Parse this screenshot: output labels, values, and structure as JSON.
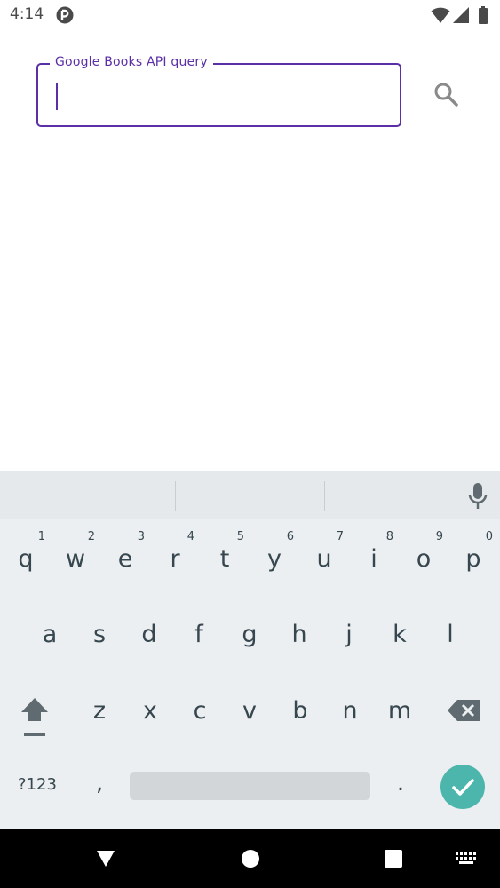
{
  "status_bar": {
    "time": "4:14"
  },
  "search": {
    "label": "Google Books API query",
    "value": "",
    "placeholder": ""
  },
  "keyboard": {
    "row1": [
      {
        "key": "q",
        "hint": "1"
      },
      {
        "key": "w",
        "hint": "2"
      },
      {
        "key": "e",
        "hint": "3"
      },
      {
        "key": "r",
        "hint": "4"
      },
      {
        "key": "t",
        "hint": "5"
      },
      {
        "key": "y",
        "hint": "6"
      },
      {
        "key": "u",
        "hint": "7"
      },
      {
        "key": "i",
        "hint": "8"
      },
      {
        "key": "o",
        "hint": "9"
      },
      {
        "key": "p",
        "hint": "0"
      }
    ],
    "row2": [
      "a",
      "s",
      "d",
      "f",
      "g",
      "h",
      "j",
      "k",
      "l"
    ],
    "row3": [
      "z",
      "x",
      "c",
      "v",
      "b",
      "n",
      "m"
    ],
    "symbols_label": "?123",
    "comma": ",",
    "period": "."
  },
  "colors": {
    "accent": "#5b2fa6",
    "keyboard_bg": "#eceff1",
    "key_text": "#37474f",
    "enter": "#4db6ac",
    "nav_bg": "#000000"
  }
}
